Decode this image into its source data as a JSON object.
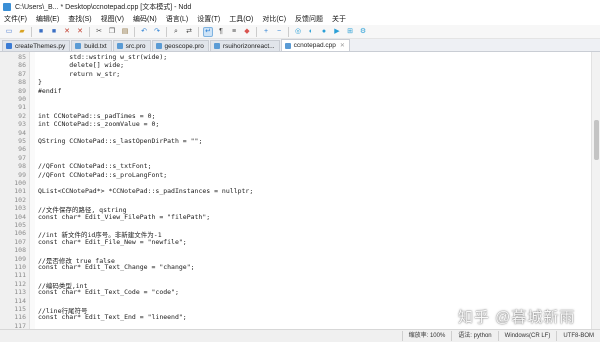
{
  "window": {
    "title": "C:\\Users\\_B... * Desktop\\ccnotepad.cpp [文本模式] - Ndd"
  },
  "menu": [
    "文件(F)",
    "编辑(E)",
    "查找(S)",
    "视图(V)",
    "编码(N)",
    "语言(L)",
    "设置(T)",
    "工具(O)",
    "对比(C)",
    "反馈问题",
    "关于"
  ],
  "toolbar": {
    "buttons": [
      {
        "name": "new-file-icon",
        "glyph": "▭",
        "color": "#4a7bd0"
      },
      {
        "name": "open-folder-icon",
        "glyph": "▰",
        "color": "#d9a321"
      },
      {
        "name": "save-icon",
        "glyph": "■",
        "color": "#3a6fc4"
      },
      {
        "name": "save-all-icon",
        "glyph": "■",
        "color": "#3a6fc4"
      },
      {
        "name": "close-icon",
        "glyph": "✕",
        "color": "#c0392b"
      },
      {
        "name": "close-all-icon",
        "glyph": "✕",
        "color": "#c0392b"
      },
      {
        "name": "cut-icon",
        "glyph": "✂",
        "color": "#555555"
      },
      {
        "name": "copy-icon",
        "glyph": "❐",
        "color": "#555555"
      },
      {
        "name": "paste-icon",
        "glyph": "▤",
        "color": "#8a6d3b"
      },
      {
        "name": "undo-icon",
        "glyph": "↶",
        "color": "#2a7fd4"
      },
      {
        "name": "redo-icon",
        "glyph": "↷",
        "color": "#2a7fd4"
      },
      {
        "name": "find-icon",
        "glyph": "⌕",
        "color": "#444444"
      },
      {
        "name": "replace-icon",
        "glyph": "⇄",
        "color": "#444444"
      },
      {
        "name": "wrap-icon",
        "glyph": "↵",
        "color": "#2a7fd4",
        "active": true
      },
      {
        "name": "show-symbols-icon",
        "glyph": "¶",
        "color": "#444444"
      },
      {
        "name": "indent-guide-icon",
        "glyph": "≡",
        "color": "#444444"
      },
      {
        "name": "bookmark-icon",
        "glyph": "◆",
        "color": "#d9534f"
      },
      {
        "name": "zoom-in-icon",
        "glyph": "+",
        "color": "#2a7fd4"
      },
      {
        "name": "zoom-out-icon",
        "glyph": "−",
        "color": "#2a7fd4"
      },
      {
        "name": "sync-scroll-icon",
        "glyph": "◎",
        "color": "#2a9fd6"
      },
      {
        "name": "compare-icon",
        "glyph": "◐",
        "color": "#2a9fd6"
      },
      {
        "name": "macro-record-icon",
        "glyph": "●",
        "color": "#2a9fd6"
      },
      {
        "name": "macro-play-icon",
        "glyph": "▶",
        "color": "#2a9fd6"
      },
      {
        "name": "encoding-icon",
        "glyph": "⊞",
        "color": "#2a9fd6"
      },
      {
        "name": "settings-icon",
        "glyph": "⚙",
        "color": "#2a9fd6"
      }
    ]
  },
  "tabs": [
    {
      "label": "createThemes.py",
      "color": "#3a7bd5",
      "active": false
    },
    {
      "label": "build.txt",
      "color": "#5a9bd5",
      "active": false
    },
    {
      "label": "src.pro",
      "color": "#5a9bd5",
      "active": false
    },
    {
      "label": "geoscope.pro",
      "color": "#5a9bd5",
      "active": false
    },
    {
      "label": "rsuihorizonreact...",
      "color": "#5a9bd5",
      "active": false
    },
    {
      "label": "ccnotepad.cpp",
      "color": "#5a9bd5",
      "active": true
    }
  ],
  "editor": {
    "lines": [
      {
        "num": "85",
        "text": "        std::wstring w_str(wide);"
      },
      {
        "num": "86",
        "text": "        delete[] wide;"
      },
      {
        "num": "87",
        "text": "        return w_str;"
      },
      {
        "num": "88",
        "text": "}"
      },
      {
        "num": "89",
        "text": "#endif"
      },
      {
        "num": "90",
        "text": ""
      },
      {
        "num": "91",
        "text": ""
      },
      {
        "num": "92",
        "text": "int CCNotePad::s_padTimes = 0;"
      },
      {
        "num": "93",
        "text": "int CCNotePad::s_zoomValue = 0;"
      },
      {
        "num": "94",
        "text": ""
      },
      {
        "num": "95",
        "text": "QString CCNotePad::s_lastOpenDirPath = \"\";"
      },
      {
        "num": "96",
        "text": ""
      },
      {
        "num": "97",
        "text": ""
      },
      {
        "num": "98",
        "text": "//QFont CCNotePad::s_txtFont;"
      },
      {
        "num": "99",
        "text": "//QFont CCNotePad::s_proLangFont;"
      },
      {
        "num": "100",
        "text": ""
      },
      {
        "num": "101",
        "text": "QList<CCNotePad*> *CCNotePad::s_padInstances = nullptr;"
      },
      {
        "num": "102",
        "text": ""
      },
      {
        "num": "103",
        "text": "//文件保存的路径, qstring"
      },
      {
        "num": "104",
        "text": "const char* Edit_View_FilePath = \"filePath\";"
      },
      {
        "num": "105",
        "text": ""
      },
      {
        "num": "106",
        "text": "//int 新文件的id序号。非新建文件为-1"
      },
      {
        "num": "107",
        "text": "const char* Edit_File_New = \"newfile\";"
      },
      {
        "num": "108",
        "text": ""
      },
      {
        "num": "109",
        "text": "//是否修改 true false"
      },
      {
        "num": "110",
        "text": "const char* Edit_Text_Change = \"change\";"
      },
      {
        "num": "111",
        "text": ""
      },
      {
        "num": "112",
        "text": "//编码类型,int"
      },
      {
        "num": "113",
        "text": "const char* Edit_Text_Code = \"code\";"
      },
      {
        "num": "114",
        "text": ""
      },
      {
        "num": "115",
        "text": "//line行尾符号"
      },
      {
        "num": "116",
        "text": "const char* Edit_Text_End = \"lineend\";"
      },
      {
        "num": "117",
        "text": ""
      }
    ]
  },
  "status": {
    "zoom": "缩放率: 100%",
    "lang": "语法: python",
    "eol": "Windows(CR LF)",
    "encoding": "UTF8-BOM"
  },
  "watermark": "知乎 @暮城新雨"
}
